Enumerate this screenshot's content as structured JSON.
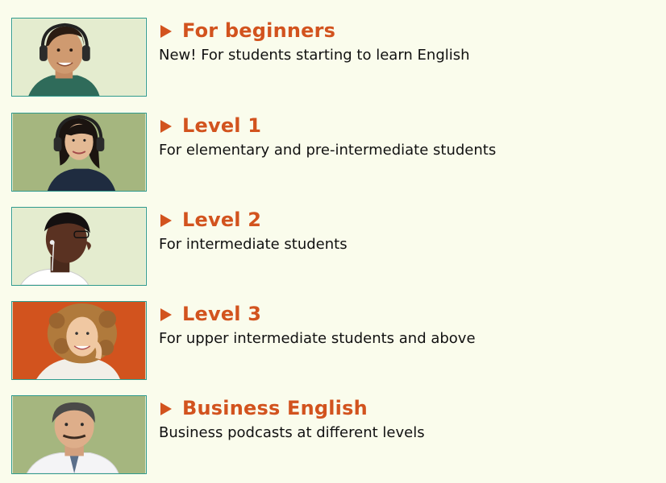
{
  "levels": [
    {
      "title": "For beginners",
      "description": "New! For students starting to learn English",
      "thumb_bg": "#e4eccf",
      "arrow_icon": "play-arrow-icon"
    },
    {
      "title": "Level 1",
      "description": "For elementary and pre-intermediate students",
      "thumb_bg": "#a5b67f",
      "arrow_icon": "play-arrow-icon"
    },
    {
      "title": "Level 2",
      "description": "For intermediate students",
      "thumb_bg": "#e4eccf",
      "arrow_icon": "play-arrow-icon"
    },
    {
      "title": "Level 3",
      "description": "For upper intermediate students and above",
      "thumb_bg": "#d2531e",
      "arrow_icon": "play-arrow-icon"
    },
    {
      "title": "Business English",
      "description": "Business podcasts at different levels",
      "thumb_bg": "#a5b67f",
      "arrow_icon": "play-arrow-icon"
    }
  ],
  "colors": {
    "page_background": "#fafcec",
    "title_accent": "#d2531e",
    "thumb_border": "#2f9a8d",
    "description_text": "#111111"
  }
}
